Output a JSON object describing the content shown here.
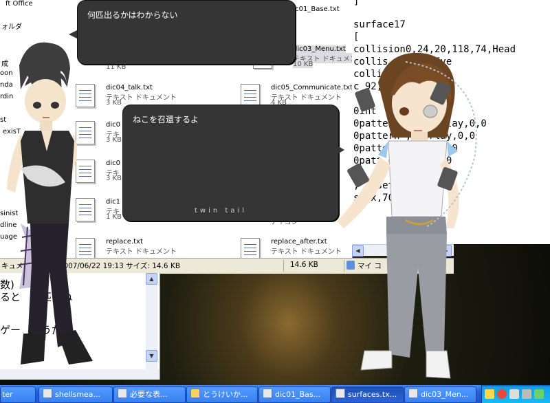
{
  "left_tree": [
    "ft Office",
    "ォルダ",
    "成",
    "oon",
    "nda",
    "rdin",
    "st",
    "exisT",
    "sinist",
    "dline",
    "uage"
  ],
  "files": [
    {
      "name": "dic01_Base.txt",
      "type": "",
      "size": ""
    },
    {
      "name": "dic03_Menu.txt",
      "type": "テキスト ドキュメント",
      "size": "10 KB"
    },
    {
      "name": "",
      "type": "",
      "size": "11 KB"
    },
    {
      "name": "dic04_talk.txt",
      "type": "テキスト ドキュメント",
      "size": "3 KB"
    },
    {
      "name": "dic05_Communicate.txt",
      "type": "テキスト ドキュメント",
      "size": "4 KB"
    },
    {
      "name": "dic0",
      "type": "テキ",
      "size": "3 KB"
    },
    {
      "name": "dic0",
      "type": "テキ",
      "size": "3 KB"
    },
    {
      "name": "dic1",
      "type": "テキ",
      "size": "1 KB"
    },
    {
      "name": "",
      "type": "",
      "size": "アイコン"
    },
    {
      "name": "replace.txt",
      "type": "テキスト ドキュメント",
      "size": ""
    },
    {
      "name": "replace_after.txt",
      "type": "テキスト ドキュメント",
      "size": ""
    }
  ],
  "statusbar": {
    "info": "キュメント 日時: 2007/06/22 19:13 サイズ: 14.6 KB",
    "size": "14.6 KB",
    "location": "マイ コ"
  },
  "editor_lines": [
    "数)",
    "ると　　匹だね",
    "",
    "ゲー　　うだが。"
  ],
  "surfaces_lines": [
    "]",
    "",
    "surface17",
    "[",
    "collision0,24,20,118,74,Head",
    "collis      ,71,96,Eye",
    "colli       9,96,Eye",
    "c           92,118,Face",
    "",
    "0int",
    "0pattern0,   ,overlay,0,0",
    "0pattern   ,overlay,0,0",
    "0patte     overlay,0,0",
    "0patt      overlay,0,0",
    "",
    "   ,   ,   setx,5",
    "         setx,70"
  ],
  "balloons": [
    {
      "text": "何匹出るかはわからない",
      "footer": ""
    },
    {
      "text": "ねこを召還するよ",
      "footer": "twin tail"
    }
  ],
  "taskbar": {
    "buttons": [
      {
        "label": "ter",
        "active": false
      },
      {
        "label": "shellsmea...",
        "active": false
      },
      {
        "label": "必要な表...",
        "active": false
      },
      {
        "label": "とうけいか...",
        "active": false
      },
      {
        "label": "dic01_Bas...",
        "active": false
      },
      {
        "label": "surfaces.tx...",
        "active": true
      },
      {
        "label": "dic03_Men...",
        "active": false
      }
    ]
  },
  "colors": {
    "balloon_bg": "#353535",
    "taskbar": "#245edb",
    "tray": "#139ee9"
  }
}
